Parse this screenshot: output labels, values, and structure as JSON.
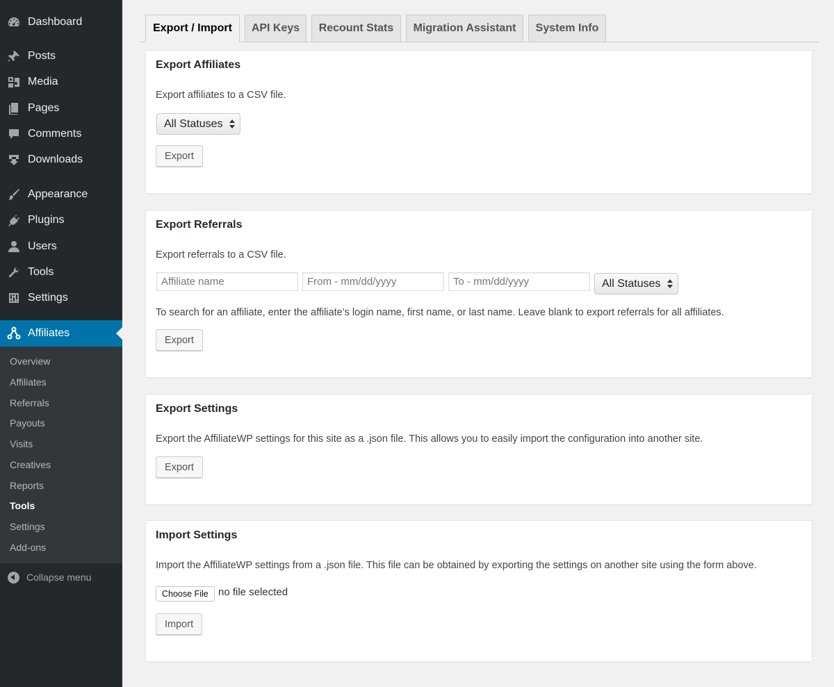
{
  "sidebar": {
    "menu": [
      {
        "label": "Dashboard",
        "icon": "dashboard-icon"
      },
      {
        "label": "Posts",
        "icon": "pin-icon"
      },
      {
        "label": "Media",
        "icon": "media-icon"
      },
      {
        "label": "Pages",
        "icon": "pages-icon"
      },
      {
        "label": "Comments",
        "icon": "comment-icon"
      },
      {
        "label": "Downloads",
        "icon": "download-icon"
      },
      {
        "label": "Appearance",
        "icon": "brush-icon"
      },
      {
        "label": "Plugins",
        "icon": "plugin-icon"
      },
      {
        "label": "Users",
        "icon": "user-icon"
      },
      {
        "label": "Tools",
        "icon": "wrench-icon"
      },
      {
        "label": "Settings",
        "icon": "sliders-icon"
      },
      {
        "label": "Affiliates",
        "icon": "affiliate-network-icon"
      }
    ],
    "submenu": [
      "Overview",
      "Affiliates",
      "Referrals",
      "Payouts",
      "Visits",
      "Creatives",
      "Reports",
      "Tools",
      "Settings",
      "Add-ons"
    ],
    "submenu_active": "Tools",
    "collapse_label": "Collapse menu",
    "accent_color": "#0073aa",
    "background_color": "#23282d"
  },
  "tabs": [
    "Export / Import",
    "API Keys",
    "Recount Stats",
    "Migration Assistant",
    "System Info"
  ],
  "active_tab": "Export / Import",
  "export_affiliates": {
    "title": "Export Affiliates",
    "description": "Export affiliates to a CSV file.",
    "status_select": "All Statuses",
    "button": "Export"
  },
  "export_referrals": {
    "title": "Export Referrals",
    "description": "Export referrals to a CSV file.",
    "affiliate_placeholder": "Affiliate name",
    "from_placeholder": "From - mm/dd/yyyy",
    "to_placeholder": "To - mm/dd/yyyy",
    "status_select": "All Statuses",
    "help_text": "To search for an affiliate, enter the affiliate’s login name, first name, or last name. Leave blank to export referrals for all affiliates.",
    "button": "Export"
  },
  "export_settings": {
    "title": "Export Settings",
    "description": "Export the AffiliateWP settings for this site as a .json file. This allows you to easily import the configuration into another site.",
    "button": "Export"
  },
  "import_settings": {
    "title": "Import Settings",
    "description": "Import the AffiliateWP settings from a .json file. This file can be obtained by exporting the settings on another site using the form above.",
    "choose_file": "Choose File",
    "file_status": "no file selected",
    "button": "Import"
  }
}
